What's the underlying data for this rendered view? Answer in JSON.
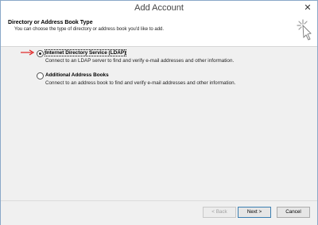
{
  "window": {
    "title": "Add Account",
    "close_glyph": "✕"
  },
  "header": {
    "title": "Directory or Address Book Type",
    "subtitle": "You can choose the type of directory or address book you'd like to add.",
    "icon": "wizard-sparkle-icon"
  },
  "options": [
    {
      "label": "Internet Directory Service (LDAP)",
      "description": "Connect to an LDAP server to find and verify e-mail addresses and other information.",
      "selected": true
    },
    {
      "label": "Additional Address Books",
      "description": "Connect to an address book to find and verify e-mail addresses and other information.",
      "selected": false
    }
  ],
  "buttons": {
    "back": "< Back",
    "next": "Next >",
    "cancel": "Cancel"
  },
  "colors": {
    "arrow": "#e02020",
    "accent": "#3c7fb1"
  }
}
